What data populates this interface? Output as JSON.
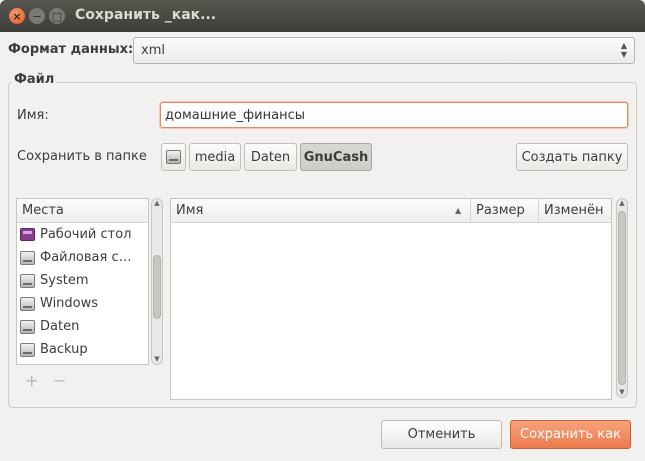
{
  "window": {
    "title": "Сохранить _как..."
  },
  "format": {
    "label": "Формат данных:",
    "value": "xml"
  },
  "file_frame": {
    "label": "Файл"
  },
  "name": {
    "label": "Имя:",
    "value": "домашние_финансы"
  },
  "save_in": {
    "label": "Сохранить в папке",
    "path": [
      {
        "label": "",
        "icon": "drive-icon"
      },
      {
        "label": "media"
      },
      {
        "label": "Daten"
      },
      {
        "label": "GnuCash",
        "active": true
      }
    ],
    "create_folder_label": "Создать папку"
  },
  "places": {
    "header": "Места",
    "items": [
      {
        "label": "Рабочий стол",
        "icon": "desktop-icon"
      },
      {
        "label": "Файловая с…",
        "icon": "drive-icon"
      },
      {
        "label": "System",
        "icon": "drive-icon"
      },
      {
        "label": "Windows",
        "icon": "drive-icon"
      },
      {
        "label": "Daten",
        "icon": "drive-icon"
      },
      {
        "label": "Backup",
        "icon": "drive-icon"
      }
    ],
    "add_label": "+",
    "remove_label": "−"
  },
  "files": {
    "columns": {
      "name": "Имя",
      "size": "Размер",
      "modified": "Изменён"
    },
    "rows": []
  },
  "buttons": {
    "cancel": "Отменить",
    "save": "Сохранить как"
  },
  "colors": {
    "accent": "#ec7a4c",
    "titlebar": "#3d3c37"
  }
}
